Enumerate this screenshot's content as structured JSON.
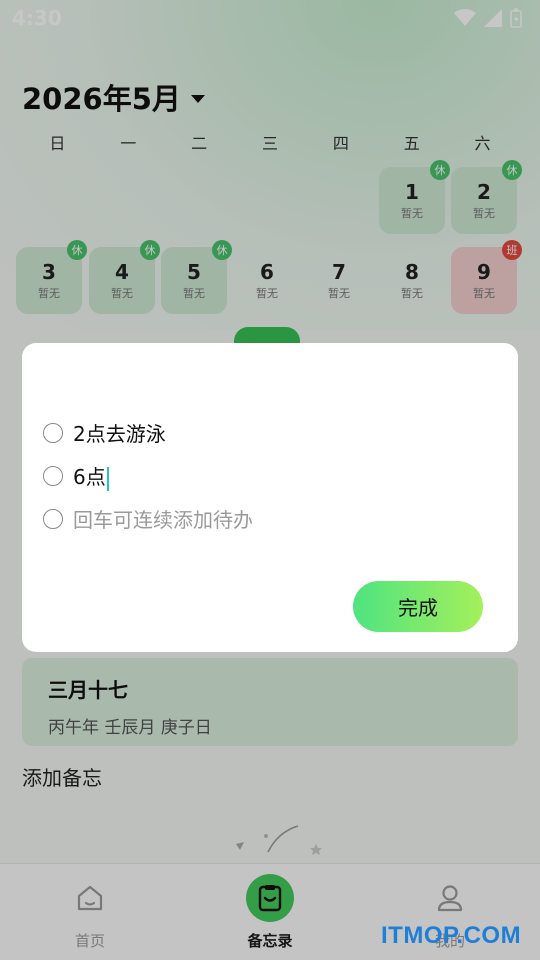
{
  "status_bar": {
    "time": "4:30"
  },
  "header": {
    "month_title": "2026年5月"
  },
  "weekdays": [
    "日",
    "一",
    "二",
    "三",
    "四",
    "五",
    "六"
  ],
  "calendar_days": [
    {
      "num": "1",
      "sub": "暂无",
      "badge": "休",
      "type": "holiday"
    },
    {
      "num": "2",
      "sub": "暂无",
      "badge": "休",
      "type": "holiday"
    },
    {
      "num": "3",
      "sub": "暂无",
      "badge": "休",
      "type": "holiday"
    },
    {
      "num": "4",
      "sub": "暂无",
      "badge": "休",
      "type": "holiday"
    },
    {
      "num": "5",
      "sub": "暂无",
      "badge": "休",
      "type": "holiday"
    },
    {
      "num": "6",
      "sub": "暂无",
      "badge": "",
      "type": "normal"
    },
    {
      "num": "7",
      "sub": "暂无",
      "badge": "",
      "type": "normal"
    },
    {
      "num": "8",
      "sub": "暂无",
      "badge": "",
      "type": "normal"
    },
    {
      "num": "9",
      "sub": "暂无",
      "badge": "班",
      "type": "work"
    }
  ],
  "lunar": {
    "date": "三月十七",
    "ganzhi": "丙午年 壬辰月 庚子日"
  },
  "memo": {
    "add_label": "添加备忘"
  },
  "dialog": {
    "items": [
      {
        "text": "2点去游泳"
      },
      {
        "text": "6点"
      }
    ],
    "placeholder": "回车可连续添加待办",
    "done_label": "完成"
  },
  "nav": {
    "home": "首页",
    "memo": "备忘录",
    "mine": "我的"
  },
  "watermark": "ITMOP.COM",
  "colors": {
    "accent": "#44c95b",
    "holiday_bg": "#cfe8d4",
    "work_bg": "#f3cfcf",
    "badge_rest": "#48c26a",
    "badge_work": "#e2493f"
  }
}
